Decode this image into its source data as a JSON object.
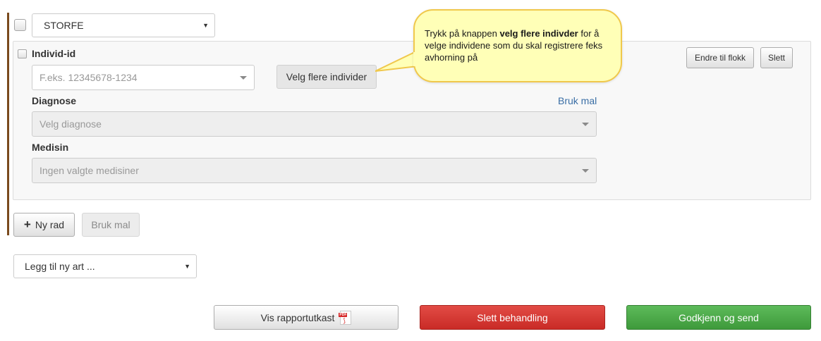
{
  "species_select": {
    "value": "STORFE"
  },
  "individual": {
    "label": "Individ-id",
    "input_placeholder": "F.eks. 12345678-1234",
    "select_multiple_label": "Velg flere individer"
  },
  "row_actions": {
    "change_to_flock_label": "Endre til flokk",
    "delete_label": "Slett"
  },
  "diagnosis": {
    "label": "Diagnose",
    "use_template_link": "Bruk mal",
    "placeholder": "Velg diagnose"
  },
  "medicine": {
    "label": "Medisin",
    "placeholder": "Ingen valgte medisiner"
  },
  "callout": {
    "text_before": "Trykk på knappen ",
    "text_bold": "velg flere indivder",
    "text_after": " for å velge individene som du skal registrere feks avhorning på"
  },
  "row_controls": {
    "new_row_label": "Ny rad",
    "use_template_label": "Bruk mal"
  },
  "add_species_select": {
    "value": "Legg til ny art ..."
  },
  "footer": {
    "report_draft_label": "Vis rapportutkast",
    "delete_treatment_label": "Slett behandling",
    "approve_send_label": "Godkjenn og send"
  },
  "colors": {
    "left_bar": "#7a4a1e",
    "danger": "#d9534f",
    "success": "#4cae4c",
    "link": "#3a6ea5",
    "callout_bg": "#ffffb7",
    "callout_border": "#f0c84c"
  },
  "icons": {
    "plus": "plus-icon",
    "pdf": "pdf-icon",
    "dropdown": "chevron-down-icon"
  }
}
